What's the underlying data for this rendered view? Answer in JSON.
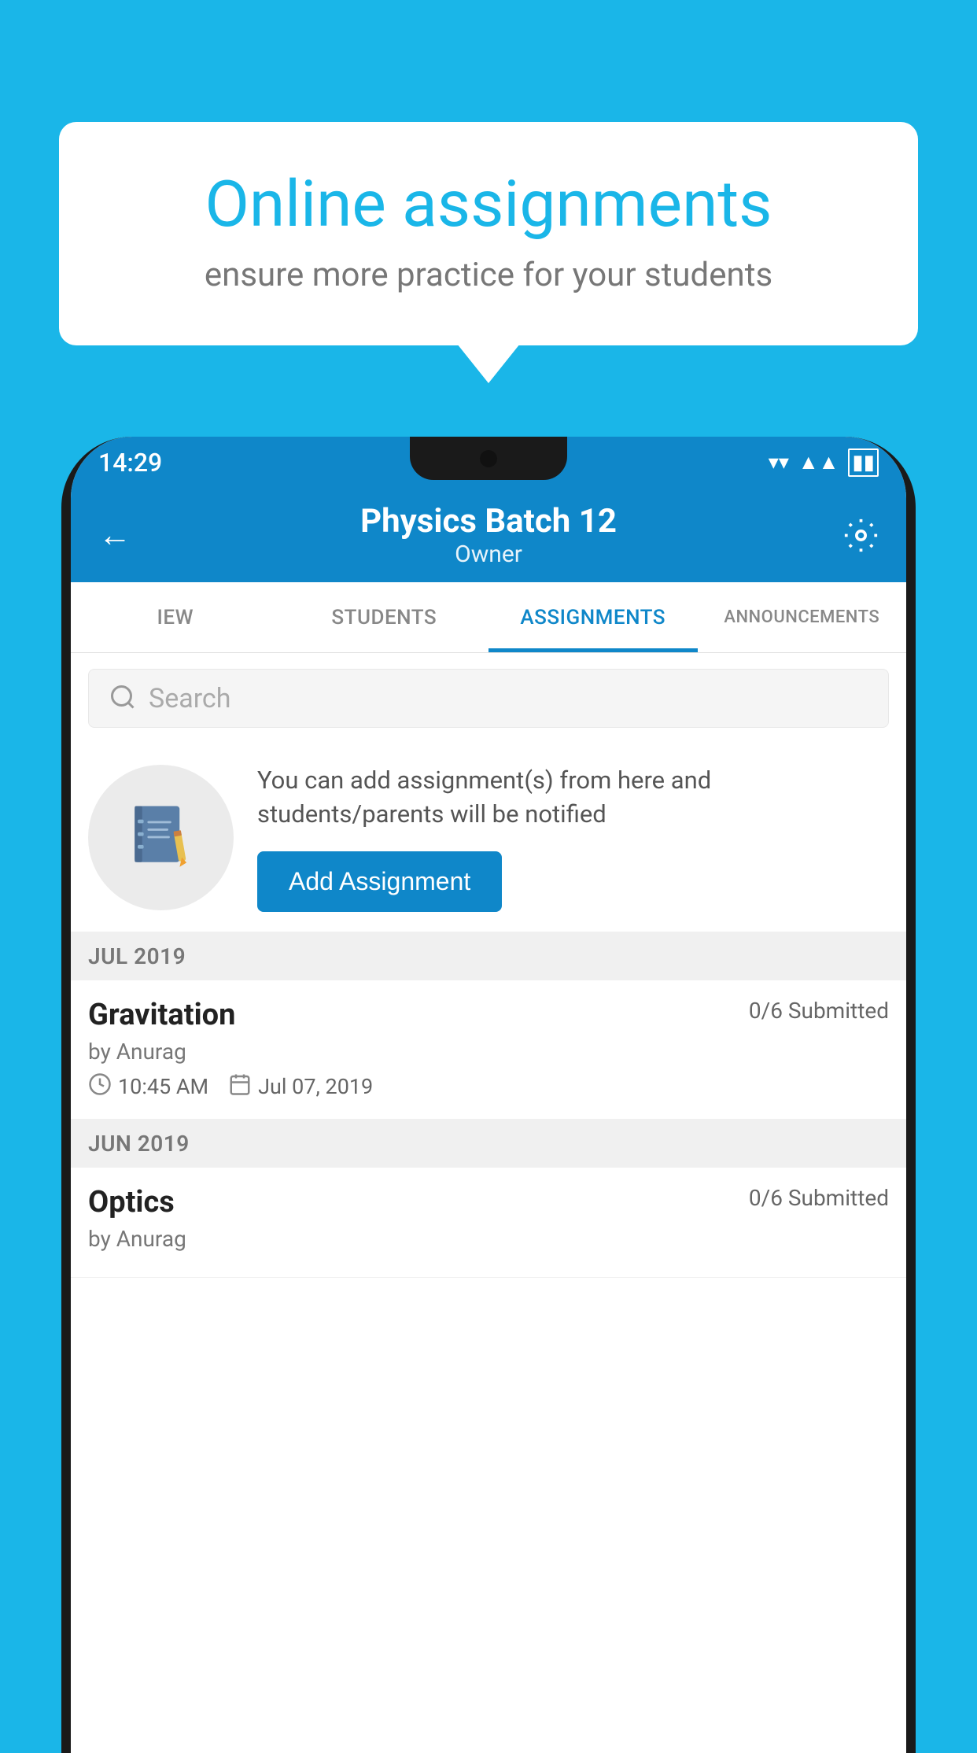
{
  "background": {
    "color": "#1ab6e8"
  },
  "speechBubble": {
    "title": "Online assignments",
    "subtitle": "ensure more practice for your students"
  },
  "phone": {
    "statusBar": {
      "time": "14:29",
      "icons": [
        "wifi",
        "signal",
        "battery"
      ]
    },
    "appBar": {
      "backLabel": "←",
      "title": "Physics Batch 12",
      "subtitle": "Owner",
      "settingsLabel": "⚙"
    },
    "tabs": [
      {
        "label": "IEW",
        "active": false
      },
      {
        "label": "STUDENTS",
        "active": false
      },
      {
        "label": "ASSIGNMENTS",
        "active": true
      },
      {
        "label": "ANNOUNCEMENTS",
        "active": false
      }
    ],
    "search": {
      "placeholder": "Search"
    },
    "emptyState": {
      "description": "You can add assignment(s) from here and students/parents will be notified",
      "buttonLabel": "Add Assignment"
    },
    "sections": [
      {
        "monthLabel": "JUL 2019",
        "assignments": [
          {
            "title": "Gravitation",
            "submitted": "0/6 Submitted",
            "author": "by Anurag",
            "time": "10:45 AM",
            "date": "Jul 07, 2019"
          }
        ]
      },
      {
        "monthLabel": "JUN 2019",
        "assignments": [
          {
            "title": "Optics",
            "submitted": "0/6 Submitted",
            "author": "by Anurag",
            "time": "",
            "date": ""
          }
        ]
      }
    ]
  }
}
